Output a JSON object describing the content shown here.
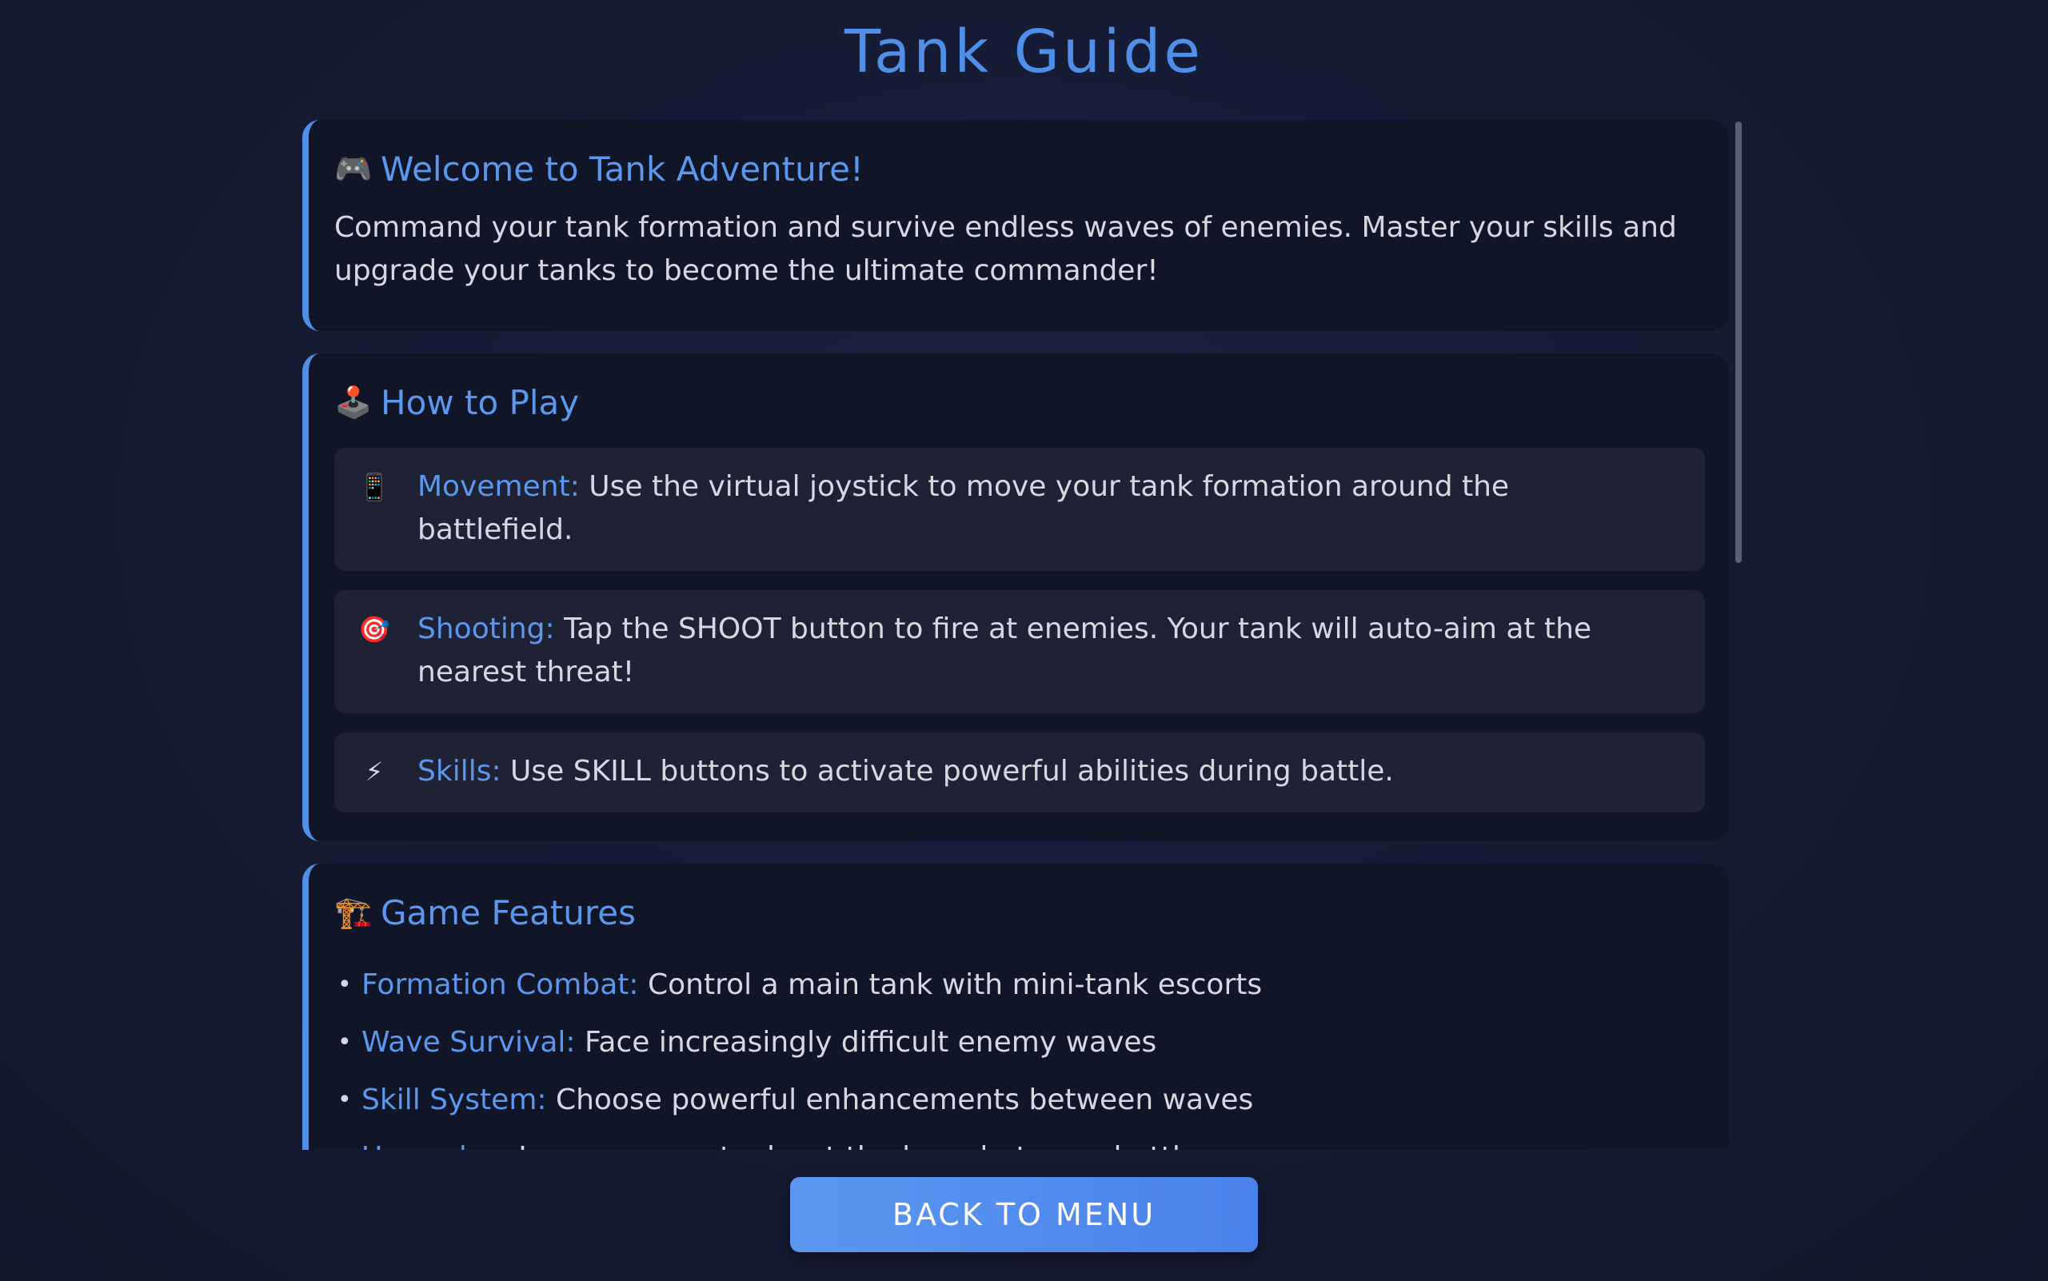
{
  "title": "Tank Guide",
  "welcome": {
    "icon": "🎮",
    "icon_name": "gamepad-icon",
    "heading": "Welcome to Tank Adventure!",
    "text": "Command your tank formation and survive endless waves of enemies. Master your skills and upgrade your tanks to become the ultimate commander!"
  },
  "how_to_play": {
    "icon": "🕹️",
    "icon_name": "joystick-icon",
    "heading": "How to Play",
    "steps": [
      {
        "icon": "📱",
        "icon_name": "phone-icon",
        "label": "Movement:",
        "text": " Use the virtual joystick to move your tank formation around the battlefield."
      },
      {
        "icon": "🎯",
        "icon_name": "target-icon",
        "label": "Shooting:",
        "text": " Tap the SHOOT button to fire at enemies. Your tank will auto-aim at the nearest threat!"
      },
      {
        "icon": "⚡",
        "icon_name": "lightning-icon",
        "label": "Skills:",
        "text": " Use SKILL buttons to activate powerful abilities during battle."
      }
    ]
  },
  "features": {
    "icon": "🏗️",
    "icon_name": "crane-icon",
    "heading": "Game Features",
    "items": [
      {
        "label": "Formation Combat:",
        "text": " Control a main tank with mini-tank escorts"
      },
      {
        "label": "Wave Survival:",
        "text": " Face increasingly difficult enemy waves"
      },
      {
        "label": "Skill System:",
        "text": " Choose powerful enhancements between waves"
      },
      {
        "label": "Upgrades:",
        "text": " Improve your tanks at the base between battles"
      }
    ]
  },
  "back_button": "BACK TO MENU",
  "colors": {
    "accent": "#4f8fea",
    "card_bg": "#111528",
    "step_bg": "#1f2234",
    "page_bg": "#161b33"
  }
}
